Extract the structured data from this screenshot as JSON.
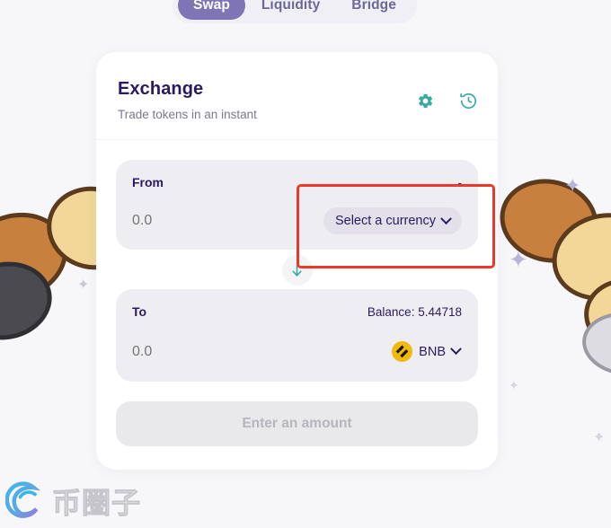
{
  "tabs": [
    {
      "label": "Swap",
      "active": true
    },
    {
      "label": "Liquidity",
      "active": false
    },
    {
      "label": "Bridge",
      "active": false
    }
  ],
  "card": {
    "title": "Exchange",
    "subtitle": "Trade tokens in an instant",
    "settings_icon": "gear-icon",
    "history_icon": "history-icon"
  },
  "from_panel": {
    "label": "From",
    "balance": "-",
    "amount_value": "0.0",
    "amount_placeholder": "0.0",
    "currency_button_label": "Select a currency",
    "chevron_icon": "chevron-down-icon"
  },
  "swap_direction": {
    "icon": "arrow-down-icon"
  },
  "to_panel": {
    "label": "To",
    "balance": "Balance: 5.44718",
    "amount_value": "0.0",
    "amount_placeholder": "0.0",
    "currency_button_label": "BNB",
    "token_icon": "bnb-token-icon",
    "chevron_icon": "chevron-down-icon"
  },
  "cta": {
    "label": "Enter an amount"
  },
  "annotation": {
    "shape": "rectangle-highlight",
    "color": "#e8392b"
  },
  "watermark": {
    "text": "币圈子",
    "logo_icon": "swirl-logo-icon"
  },
  "colors": {
    "accent_purple": "#7f74b5",
    "title_navy": "#2b1b5e",
    "icon_teal": "#3aa9a4",
    "bnb_yellow": "#f0b90b",
    "panel_gray": "#eeedf2",
    "annotation_red": "#e8392b"
  },
  "decor": {
    "sparkle_glyph": "✦",
    "pancake_shapes": "background-pancakes"
  }
}
